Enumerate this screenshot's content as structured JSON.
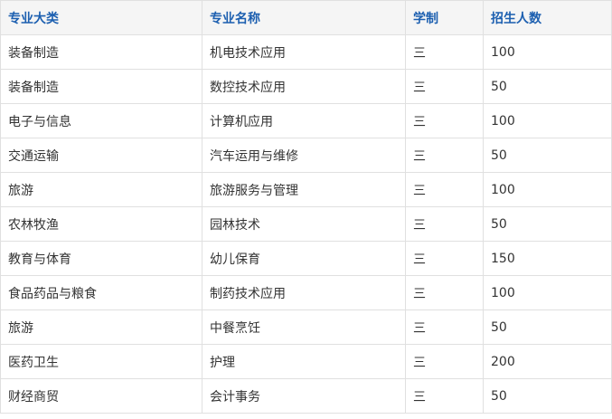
{
  "table": {
    "headers": [
      "专业大类",
      "专业名称",
      "学制",
      "招生人数"
    ],
    "rows": [
      [
        "装备制造",
        "机电技术应用",
        "三",
        "100"
      ],
      [
        "装备制造",
        "数控技术应用",
        "三",
        "50"
      ],
      [
        "电子与信息",
        "计算机应用",
        "三",
        "100"
      ],
      [
        "交通运输",
        "汽车运用与维修",
        "三",
        "50"
      ],
      [
        "旅游",
        "旅游服务与管理",
        "三",
        "100"
      ],
      [
        "农林牧渔",
        "园林技术",
        "三",
        "50"
      ],
      [
        "教育与体育",
        "幼儿保育",
        "三",
        "150"
      ],
      [
        "食品药品与粮食",
        "制药技术应用",
        "三",
        "100"
      ],
      [
        "旅游",
        "中餐烹饪",
        "三",
        "50"
      ],
      [
        "医药卫生",
        "护理",
        "三",
        "200"
      ],
      [
        "财经商贸",
        "会计事务",
        "三",
        "50"
      ]
    ]
  },
  "colors": {
    "header_text": "#1c5fb0",
    "header_bg": "#f5f5f5",
    "cell_text": "#333333",
    "border": "#e0e0e0"
  }
}
